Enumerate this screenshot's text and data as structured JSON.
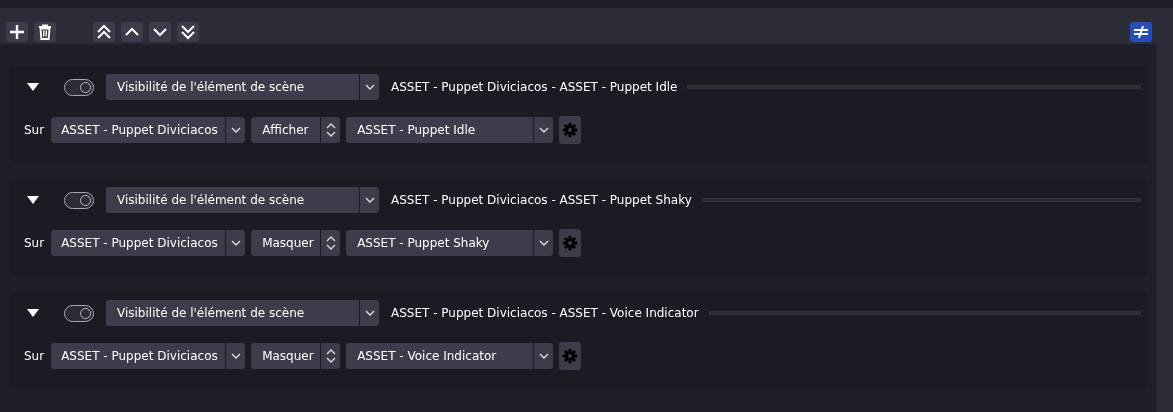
{
  "toolbar": {
    "filter_active": true
  },
  "actions": [
    {
      "expanded": true,
      "enabled": true,
      "type": "Visibilité de l'élément de scène",
      "summary": "ASSET - Puppet Diviciacos - ASSET - Puppet Idle",
      "on_label": "Sur",
      "scene": "ASSET - Puppet Diviciacos",
      "mode": "Afficher",
      "source": "ASSET - Puppet Idle"
    },
    {
      "expanded": true,
      "enabled": true,
      "type": "Visibilité de l'élément de scène",
      "summary": "ASSET - Puppet Diviciacos - ASSET - Puppet Shaky",
      "on_label": "Sur",
      "scene": "ASSET - Puppet Diviciacos",
      "mode": "Masquer",
      "source": "ASSET - Puppet Shaky"
    },
    {
      "expanded": true,
      "enabled": true,
      "type": "Visibilité de l'élément de scène",
      "summary": "ASSET - Puppet Diviciacos - ASSET - Voice Indicator",
      "on_label": "Sur",
      "scene": "ASSET - Puppet Diviciacos",
      "mode": "Masquer",
      "source": "ASSET - Voice Indicator"
    }
  ]
}
